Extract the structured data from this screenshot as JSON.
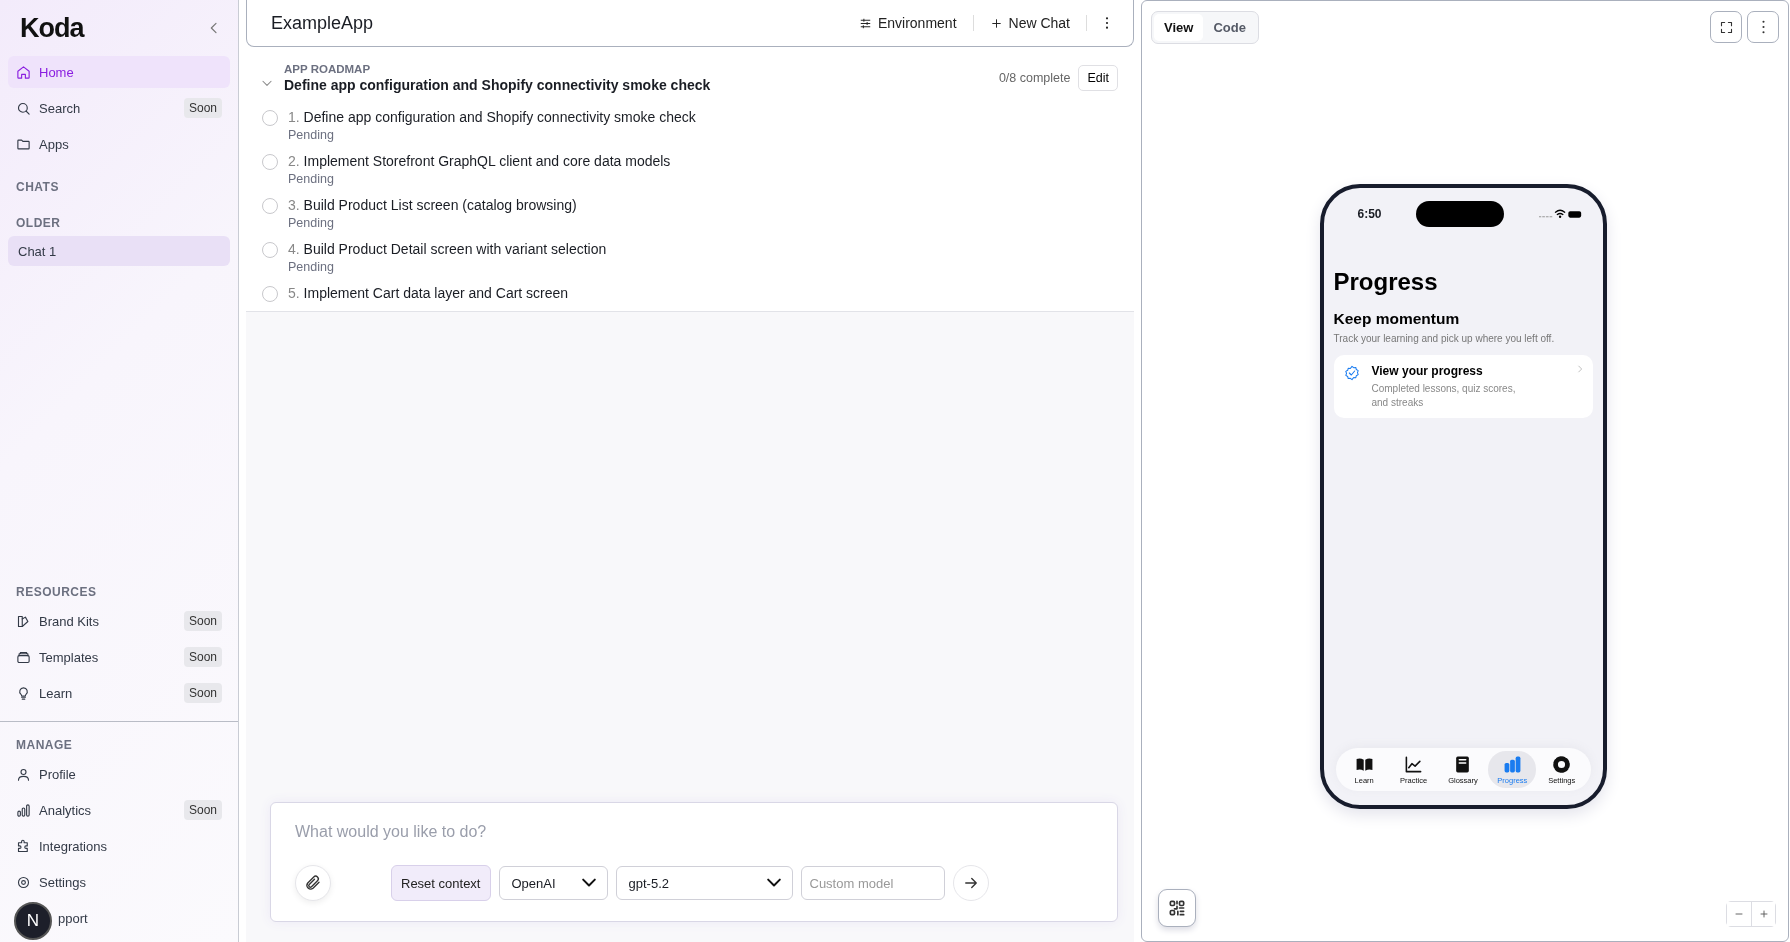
{
  "sidebar": {
    "logo": "Koda",
    "nav": [
      {
        "label": "Home",
        "selected": true
      },
      {
        "label": "Search",
        "badge": "Soon",
        "selected": false
      },
      {
        "label": "Apps",
        "selected": false
      }
    ],
    "chats": {
      "heading": "CHATS",
      "groups": [
        {
          "heading": "OLDER",
          "items": [
            {
              "label": "Chat 1",
              "selected": true
            }
          ]
        }
      ]
    },
    "resources": {
      "heading": "RESOURCES",
      "items": [
        {
          "label": "Brand Kits",
          "badge": "Soon",
          "selected": false
        },
        {
          "label": "Templates",
          "badge": "Soon",
          "selected": false
        },
        {
          "label": "Learn",
          "badge": "Soon",
          "selected": false
        }
      ]
    },
    "manage": {
      "heading": "MANAGE",
      "items": [
        {
          "label": "Profile",
          "selected": false,
          "kind": "plain"
        },
        {
          "label": "Analytics",
          "badge": "Soon",
          "selected": false,
          "kind": "plain"
        },
        {
          "label": "Integrations",
          "selected": false,
          "kind": "plain"
        },
        {
          "label": "Settings",
          "selected": false,
          "kind": "plain"
        },
        {
          "label": "pport",
          "selected": false,
          "kind": "covered"
        }
      ]
    },
    "avatar": "N"
  },
  "header": {
    "title": "ExampleApp",
    "environment": "Environment",
    "new_chat": "New Chat"
  },
  "roadmap": {
    "label": "APP ROADMAP",
    "title": "Define app configuration and Shopify connectivity smoke check",
    "progress": "0/8 complete",
    "edit": "Edit",
    "items": [
      {
        "number": "1.",
        "title": "Define app configuration and Shopify connectivity smoke check",
        "status": "Pending",
        "checked": false
      },
      {
        "number": "2.",
        "title": "Implement Storefront GraphQL client and core data models",
        "status": "Pending",
        "checked": false
      },
      {
        "number": "3.",
        "title": "Build Product List screen (catalog browsing)",
        "status": "Pending",
        "checked": false
      },
      {
        "number": "4.",
        "title": "Build Product Detail screen with variant selection",
        "status": "Pending",
        "checked": false
      },
      {
        "number": "5.",
        "title": "Implement Cart data layer and Cart screen",
        "checked": false
      }
    ]
  },
  "composer": {
    "placeholder": "What would you like to do?",
    "reset": "Reset context",
    "provider": "OpenAI",
    "model": "gpt-5.2",
    "custom_placeholder": "Custom model"
  },
  "preview": {
    "tabs": [
      {
        "label": "View",
        "selected": true
      },
      {
        "label": "Code",
        "selected": false
      }
    ],
    "phone": {
      "time": "6:50",
      "title": "Progress",
      "heading": "Keep momentum",
      "subtitle": "Track your learning and pick up where you left off.",
      "card": {
        "title": "View your progress",
        "text": "Completed lessons, quiz scores, and streaks"
      },
      "tabs": [
        {
          "label": "Learn",
          "selected": false
        },
        {
          "label": "Practice",
          "selected": false
        },
        {
          "label": "Glossary",
          "selected": false
        },
        {
          "label": "Progress",
          "selected": true
        },
        {
          "label": "Settings",
          "selected": false
        }
      ]
    }
  }
}
